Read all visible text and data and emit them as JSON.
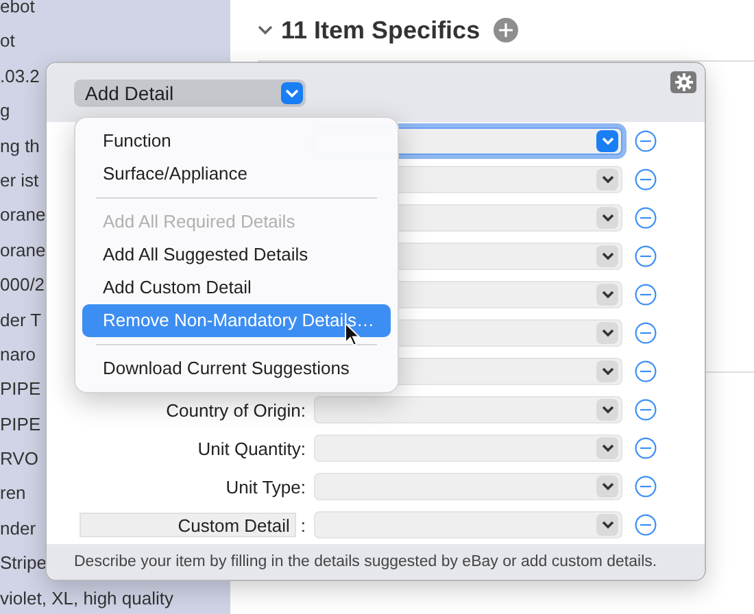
{
  "sidebar": {
    "items": [
      {
        "label": "ebot"
      },
      {
        "label": "ot"
      },
      {
        "label": ".03.2"
      },
      {
        "label": "g"
      },
      {
        "label": "ng th"
      },
      {
        "label": "er ist"
      },
      {
        "label": "orane"
      },
      {
        "label": "orane"
      },
      {
        "label": "000/2"
      },
      {
        "label": "der T"
      },
      {
        "label": "naro"
      },
      {
        "label": "PIPE"
      },
      {
        "label": "PIPE"
      },
      {
        "label": "RVO"
      },
      {
        "label": "ren"
      },
      {
        "label": "nder"
      },
      {
        "label": "Stripe"
      },
      {
        "label": "violet, XL, high quality"
      }
    ]
  },
  "section": {
    "title": "11 Item Specifics",
    "expanded": true
  },
  "popover": {
    "add_detail": {
      "label": "Add Detail"
    },
    "rows": [
      {
        "kind": "select",
        "focused": true
      },
      {
        "kind": "select",
        "focused": false
      },
      {
        "kind": "select",
        "focused": false
      },
      {
        "kind": "select",
        "focused": false
      },
      {
        "kind": "select",
        "focused": false
      },
      {
        "kind": "select",
        "focused": false
      },
      {
        "kind": "select",
        "focused": false
      },
      {
        "kind": "select",
        "focused": false,
        "label": "Country of Origin:"
      },
      {
        "kind": "select",
        "focused": false,
        "label": "Unit Quantity:"
      },
      {
        "kind": "select",
        "focused": false,
        "label": "Unit Type:"
      },
      {
        "kind": "custom",
        "focused": false,
        "label": "Custom Detail",
        "separator": ":"
      }
    ],
    "footer": "Describe your item by filling in the details suggested by eBay or add custom details."
  },
  "menu": {
    "items": [
      {
        "kind": "item",
        "label": "Function",
        "disabled": false,
        "selected": false
      },
      {
        "kind": "item",
        "label": "Surface/Appliance",
        "disabled": false,
        "selected": false
      },
      {
        "kind": "separator"
      },
      {
        "kind": "item",
        "label": "Add All Required Details",
        "disabled": true,
        "selected": false
      },
      {
        "kind": "item",
        "label": "Add All Suggested Details",
        "disabled": false,
        "selected": false
      },
      {
        "kind": "item",
        "label": "Add Custom Detail",
        "disabled": false,
        "selected": false
      },
      {
        "kind": "item",
        "label": "Remove Non-Mandatory Details…",
        "disabled": false,
        "selected": true
      },
      {
        "kind": "separator"
      },
      {
        "kind": "item",
        "label": "Download Current Suggestions",
        "disabled": false,
        "selected": false
      }
    ]
  }
}
